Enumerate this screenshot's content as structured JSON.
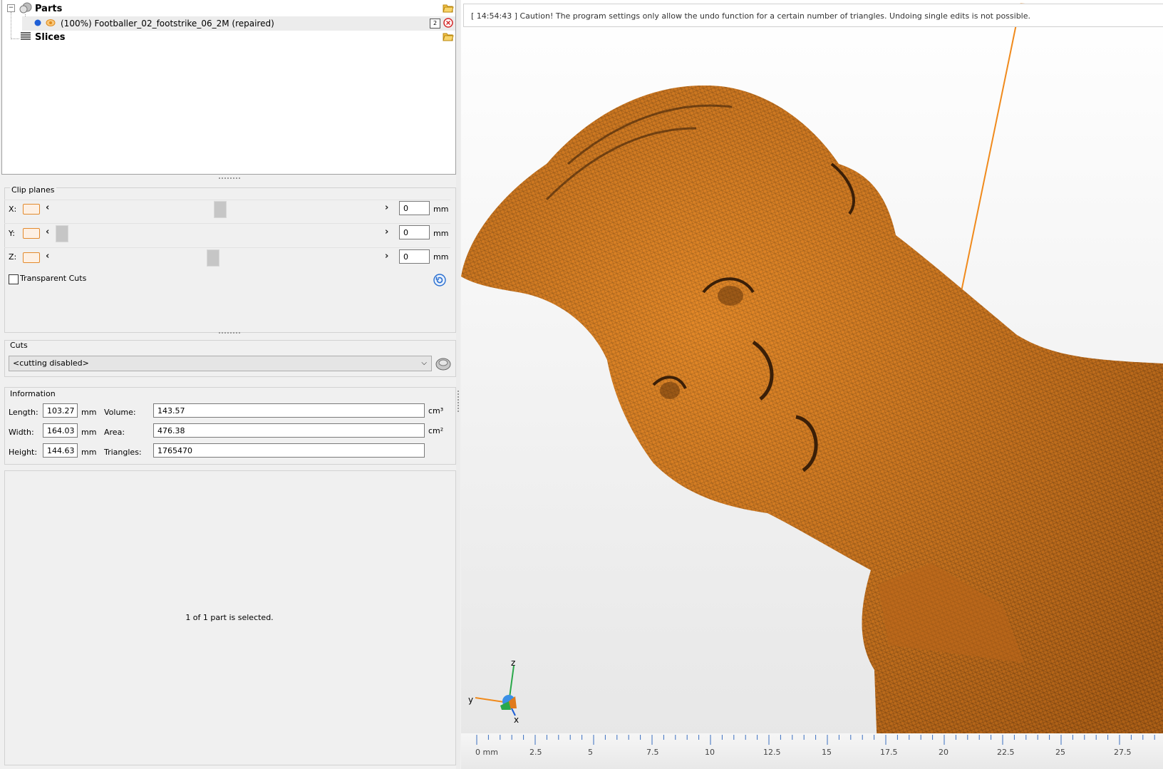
{
  "tree": {
    "parts_label": "Parts",
    "part_item": "(100%) Footballer_02_footstrike_06_2M (repaired)",
    "part_badge": "2",
    "slices_label": "Slices"
  },
  "clip_planes": {
    "title": "Clip planes",
    "rows": [
      {
        "axis": "X:",
        "value": "0",
        "unit": "mm",
        "slider_fraction": 0.47
      },
      {
        "axis": "Y:",
        "value": "0",
        "unit": "mm",
        "slider_fraction": 0.02
      },
      {
        "axis": "Z:",
        "value": "0",
        "unit": "mm",
        "slider_fraction": 0.45
      }
    ],
    "transparent_cuts_label": "Transparent Cuts"
  },
  "cuts": {
    "title": "Cuts",
    "selected": "<cutting disabled>"
  },
  "information": {
    "title": "Information",
    "length_label": "Length:",
    "length_value": "103.27",
    "width_label": "Width:",
    "width_value": "164.03",
    "height_label": "Height:",
    "height_value": "144.63",
    "mm_unit": "mm",
    "volume_label": "Volume:",
    "volume_value": "143.57",
    "area_label": "Area:",
    "area_value": "476.38",
    "triangles_label": "Triangles:",
    "triangles_value": "1765470",
    "cm3_unit": "cm³",
    "cm2_unit": "cm²"
  },
  "selection_status": "1 of 1 part is selected.",
  "viewport": {
    "message": "[ 14:54:43 ] Caution! The program settings only allow the undo function for a certain number of triangles. Undoing single edits is not possible.",
    "axis_labels": {
      "z": "z",
      "y": "y",
      "x": "x"
    },
    "ruler_labels": [
      "0 mm",
      "2.5",
      "5",
      "7.5",
      "10",
      "12.5",
      "15",
      "17.5",
      "20",
      "22.5",
      "25",
      "27.5"
    ],
    "model_color": "#d97a1e",
    "accent_color": "#f08a1c"
  }
}
